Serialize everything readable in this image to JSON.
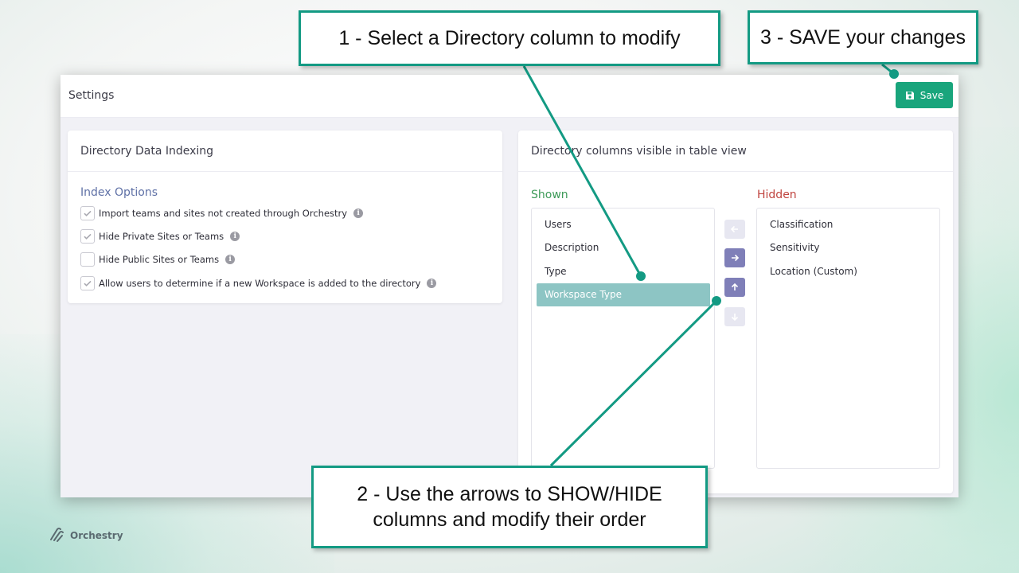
{
  "callouts": {
    "step1": "1 - Select a Directory column to modify",
    "step2_line1": "2 - Use the arrows to SHOW/HIDE",
    "step2_line2": "columns and modify their order",
    "step3": "3 - SAVE your changes"
  },
  "header": {
    "title": "Settings",
    "save_label": "Save"
  },
  "indexing": {
    "title": "Directory Data Indexing",
    "options_title": "Index Options",
    "options": [
      {
        "label": "Import teams and sites not created through Orchestry",
        "checked": true
      },
      {
        "label": "Hide Private Sites or Teams",
        "checked": true
      },
      {
        "label": "Hide Public Sites or Teams",
        "checked": false
      },
      {
        "label": "Allow users to determine if a new Workspace is added to the directory",
        "checked": true
      }
    ]
  },
  "columns": {
    "title": "Directory columns visible in table view",
    "shown_label": "Shown",
    "hidden_label": "Hidden",
    "shown": [
      "Users",
      "Description",
      "Type",
      "Workspace Type"
    ],
    "selected": "Workspace Type",
    "hidden": [
      "Classification",
      "Sensitivity",
      "Location (Custom)"
    ]
  },
  "brand": {
    "name": "Orchestry"
  },
  "colors": {
    "accent": "#139a83",
    "save": "#19a57c",
    "selected_item": "#8dc5c4",
    "arrow_enabled": "#7f7fb8",
    "shown": "#3e9b59",
    "hidden": "#c0443f"
  }
}
